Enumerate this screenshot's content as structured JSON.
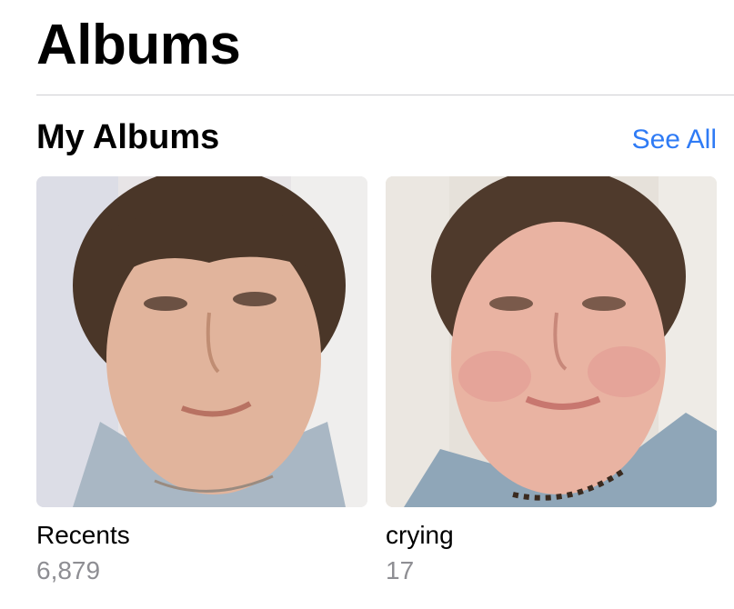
{
  "header": {
    "title": "Albums"
  },
  "section": {
    "title": "My Albums",
    "see_all_label": "See All",
    "accent_color": "#2f7bf5"
  },
  "albums": [
    {
      "name": "Recents",
      "count": "6,879",
      "thumbnail": "selfie-photo"
    },
    {
      "name": "crying",
      "count": "17",
      "thumbnail": "selfie-photo"
    }
  ]
}
